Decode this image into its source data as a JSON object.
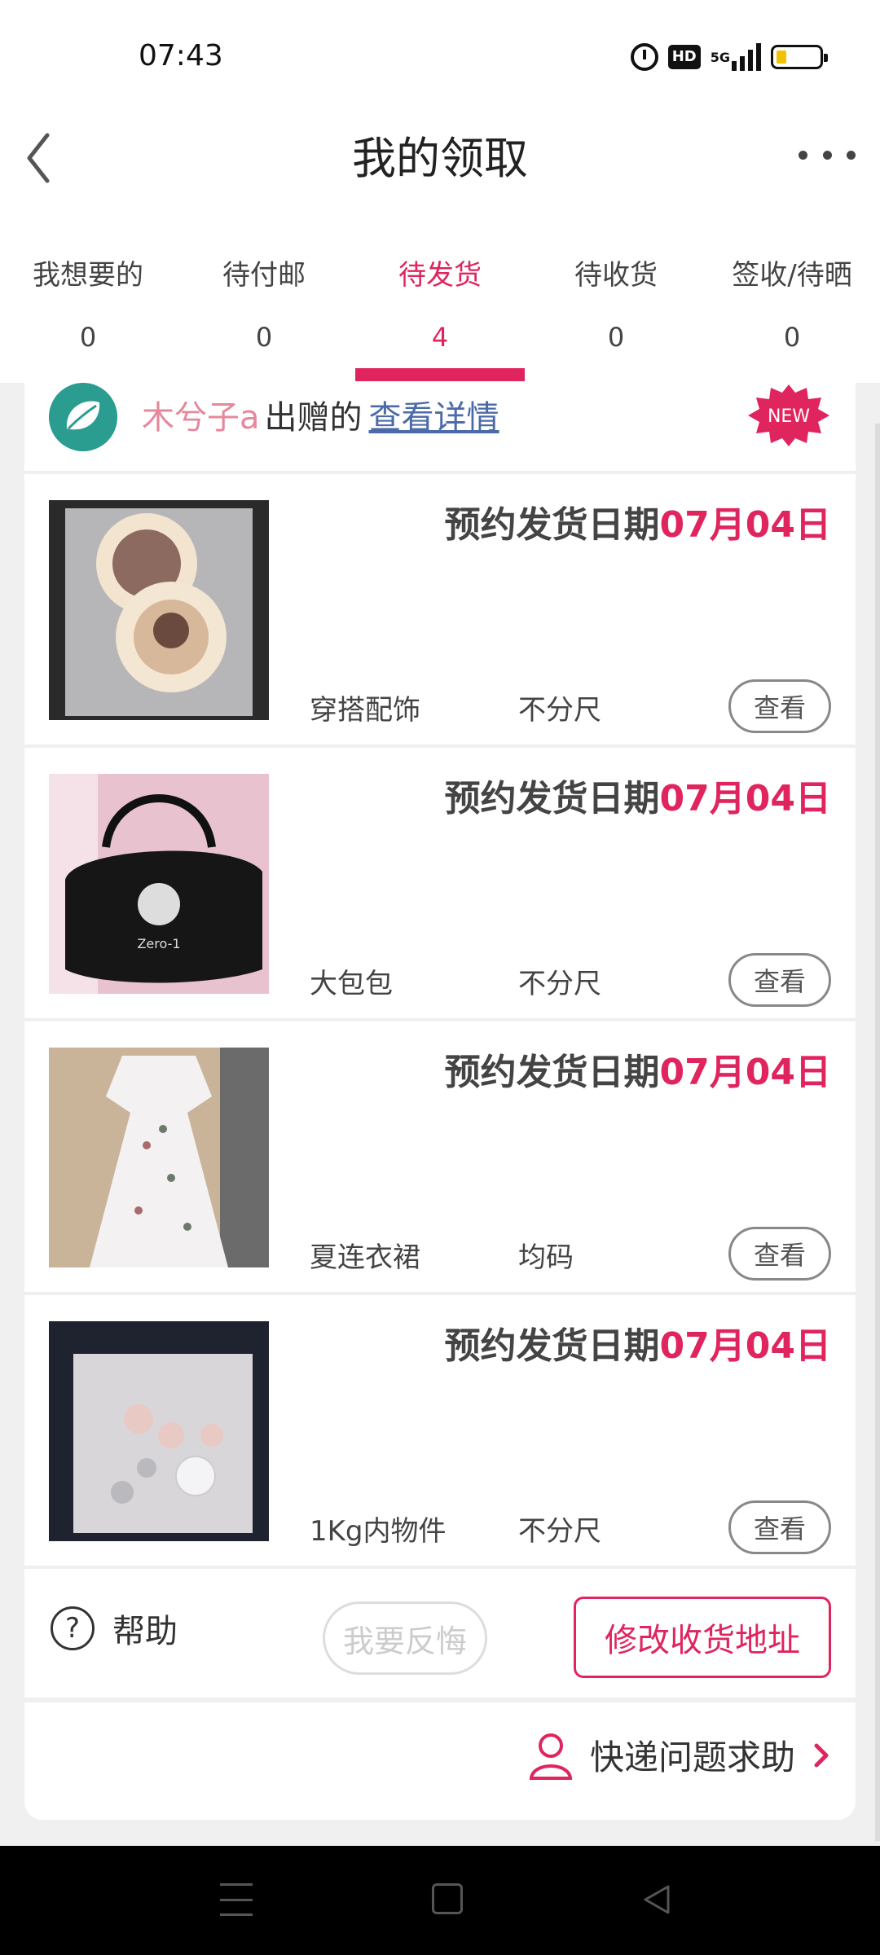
{
  "status": {
    "time": "07:43",
    "hd": "HD",
    "network": "5G"
  },
  "nav": {
    "title": "我的领取"
  },
  "tabs": [
    {
      "label": "我想要的",
      "count": "0"
    },
    {
      "label": "待付邮",
      "count": "0"
    },
    {
      "label": "待发货",
      "count": "4"
    },
    {
      "label": "待收货",
      "count": "0"
    },
    {
      "label": "签收/待晒",
      "count": "0"
    }
  ],
  "giver": {
    "name": "木兮子a",
    "text": "出赠的",
    "link": "查看详情",
    "badge": "NEW"
  },
  "date_prefix": "预约发货日期",
  "items": [
    {
      "date": "07月04日",
      "name": "穿搭配饰",
      "size": "不分尺",
      "button": "查看"
    },
    {
      "date": "07月04日",
      "name": "大包包",
      "size": "不分尺",
      "button": "查看"
    },
    {
      "date": "07月04日",
      "name": "夏连衣裙",
      "size": "均码",
      "button": "查看"
    },
    {
      "date": "07月04日",
      "name": "1Kg内物件",
      "size": "不分尺",
      "button": "查看"
    }
  ],
  "actions": {
    "help": "帮助",
    "regret": "我要反悔",
    "change_address": "修改收货地址"
  },
  "express": {
    "label": "快递问题求助"
  },
  "colors": {
    "accent": "#e0245e",
    "link": "#4a6aa8"
  }
}
